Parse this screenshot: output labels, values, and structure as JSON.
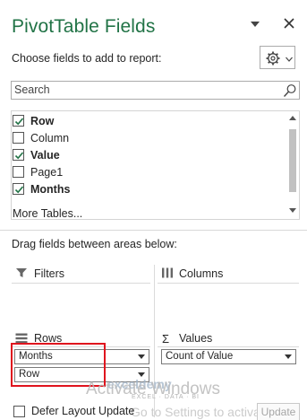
{
  "panel": {
    "title": "PivotTable Fields",
    "choose_label": "Choose fields to add to report:"
  },
  "search": {
    "placeholder": "Search"
  },
  "fields": [
    {
      "label": "Row",
      "checked": true,
      "bold": true
    },
    {
      "label": "Column",
      "checked": false,
      "bold": false
    },
    {
      "label": "Value",
      "checked": true,
      "bold": true
    },
    {
      "label": "Page1",
      "checked": false,
      "bold": false
    },
    {
      "label": "Months",
      "checked": true,
      "bold": true
    }
  ],
  "more_tables": "More Tables...",
  "drag_label": "Drag fields between areas below:",
  "areas": {
    "filters": {
      "label": "Filters",
      "items": []
    },
    "columns": {
      "label": "Columns",
      "items": []
    },
    "rows": {
      "label": "Rows",
      "items": [
        "Months",
        "Row"
      ]
    },
    "values": {
      "label": "Values",
      "items": [
        "Count of Value"
      ]
    }
  },
  "footer": {
    "defer_label": "Defer Layout Update",
    "defer_checked": false,
    "update_label": "Update"
  },
  "watermark": {
    "logo": "exceldemy",
    "sub": "EXCEL · DATA · BI",
    "activate": "Activate Windows",
    "goto": "Go to Settings to activate Windows."
  },
  "colors": {
    "title": "#217346",
    "highlight": "#e0141e",
    "check": "#217346"
  }
}
